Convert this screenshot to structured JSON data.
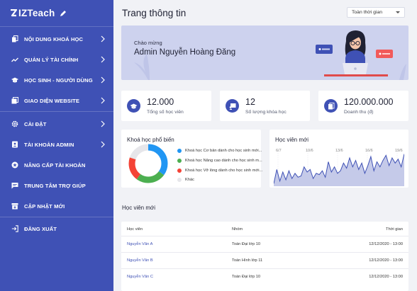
{
  "brand": {
    "name": "IZTeach"
  },
  "sidebar": {
    "items": [
      {
        "label": "NỘI DUNG KHOÁ HỌC",
        "icon": "copy-icon"
      },
      {
        "label": "QUẢN LÝ TÀI CHÍNH",
        "icon": "trend-icon"
      },
      {
        "label": "HỌC SINH - NGƯỜI DÙNG",
        "icon": "graduation-icon"
      },
      {
        "label": "GIAO DIỆN WEBSITE",
        "icon": "gallery-icon"
      },
      {
        "label": "CÀI ĐẶT",
        "icon": "gear-icon"
      },
      {
        "label": "TÀI KHOẢN ADMIN",
        "icon": "id-badge-icon"
      },
      {
        "label": "NÂNG CẤP TÀI KHOẢN",
        "icon": "star-icon"
      },
      {
        "label": "TRUNG TÂM TRỢ GIÚP",
        "icon": "chat-icon"
      },
      {
        "label": "CẬP NHẬT MỚI",
        "icon": "archive-icon"
      },
      {
        "label": "ĐĂNG XUẤT",
        "icon": "logout-icon"
      }
    ]
  },
  "header": {
    "title": "Trang thông tin",
    "range_select": "Toàn thời gian"
  },
  "banner": {
    "greeting": "Chào mừng",
    "admin_name": "Admin Nguyễn Hoàng Đăng"
  },
  "stats": [
    {
      "value": "12.000",
      "label": "Tổng số học viên",
      "icon": "graduation-icon"
    },
    {
      "value": "12",
      "label": "Số lượng khóa học",
      "icon": "board-icon"
    },
    {
      "value": "120.000.000",
      "label": "Doanh thu (đ)",
      "icon": "document-icon"
    }
  ],
  "popular_courses": {
    "title": "Khoá học phổ biến",
    "chart_data": {
      "type": "pie",
      "labels": [
        "Khoá học Cơ bản dành cho học sinh mới...",
        "Khoá học Nâng cao dành cho học sinh m...",
        "Khoá học Vỡ lòng dành cho học sinh mới...",
        "Khác"
      ],
      "values": [
        35,
        25,
        20,
        20
      ],
      "colors": [
        "#2196f3",
        "#4caf50",
        "#f44336",
        "#e6e6ea"
      ]
    }
  },
  "new_students_chart": {
    "title": "Học viên mới",
    "chart_data": {
      "type": "area",
      "x_ticks": [
        "6/7",
        "10/6",
        "13/6",
        "16/6",
        "19/6"
      ],
      "values": [
        4,
        26,
        8,
        22,
        10,
        24,
        12,
        20,
        14,
        16,
        30,
        22,
        26,
        12,
        20,
        18,
        24,
        14,
        38,
        22,
        30,
        20,
        24,
        36,
        28,
        44,
        30,
        40,
        26,
        36,
        20,
        32,
        46,
        24,
        38,
        30,
        40,
        48,
        32,
        44,
        36,
        42,
        30,
        50
      ],
      "color": "#3f51b5"
    }
  },
  "new_students_table": {
    "title": "Học viên mới",
    "columns": [
      "Học viên",
      "Nhóm",
      "Thời gian"
    ],
    "rows": [
      {
        "name": "Nguyễn Văn A",
        "group": "Toán Đại lớp 10",
        "time": "12/12/2020 - 13:00"
      },
      {
        "name": "Nguyễn Văn B",
        "group": "Toán Hình lớp 11",
        "time": "12/12/2020 - 13:00"
      },
      {
        "name": "Nguyễn Văn C",
        "group": "Toán Đại lớp 10",
        "time": "12/12/2020 - 13:00"
      }
    ]
  }
}
